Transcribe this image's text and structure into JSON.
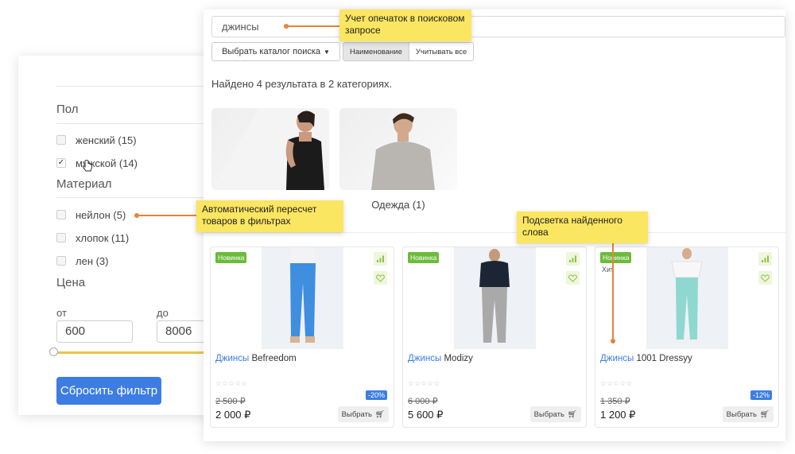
{
  "filter": {
    "gender": {
      "title": "Пол",
      "options": [
        {
          "label": "женский (15)",
          "checked": false
        },
        {
          "label": "мужской (14)",
          "checked": true
        }
      ]
    },
    "material": {
      "title": "Материал",
      "options": [
        {
          "label": "нейлон (5)",
          "checked": false
        },
        {
          "label": "хлопок (11)",
          "checked": false
        },
        {
          "label": "лен (3)",
          "checked": false
        }
      ]
    },
    "price": {
      "title": "Цена",
      "from_label": "от",
      "to_label": "до",
      "from_value": "600",
      "to_value": "8006"
    },
    "reset_label": "Сбросить фильтр"
  },
  "search": {
    "query": "джинсы",
    "catalog_button": "Выбрать каталог поиска",
    "tabs": [
      {
        "label": "Наименование",
        "active": true
      },
      {
        "label": "Учитывать все",
        "active": false
      }
    ],
    "summary": "Найдено 4 результата в 2 категориях.",
    "category_label": "Одежда (1)"
  },
  "products": [
    {
      "badge": "Новинка",
      "hit": "",
      "name_highlight": "Джинсы",
      "name_rest": " Befreedom",
      "old_price": "2 500 ₽",
      "discount": "-20%",
      "price": "2 000 ₽",
      "buy_label": "Выбрать",
      "jeans_color": "#3f8ee0",
      "top_color": "#f3f3f3"
    },
    {
      "badge": "Новинка",
      "hit": "",
      "name_highlight": "Джинсы",
      "name_rest": " Modizy",
      "old_price": "6 000 ₽",
      "discount": "",
      "price": "5 600 ₽",
      "buy_label": "Выбрать",
      "jeans_color": "#a9a9a9",
      "top_color": "#1c2533"
    },
    {
      "badge": "Новинка",
      "hit": "Хит",
      "name_highlight": "Джинсы",
      "name_rest": " 1001 Dressyy",
      "old_price": "1 350 ₽",
      "discount": "-12%",
      "price": "1 200 ₽",
      "buy_label": "Выбрать",
      "jeans_color": "#8fd8cf",
      "top_color": "#f7f7f7"
    }
  ],
  "callouts": {
    "typo": "Учет опечаток в поисковом запросе",
    "recount": "Автоматический пересчет товаров в фильтрах",
    "highlight": "Подсветка найденного слова"
  },
  "colors": {
    "accent": "#3d7de3",
    "badge_new": "#6cbb3c",
    "callout": "#fae660",
    "leader": "#e8823a"
  }
}
